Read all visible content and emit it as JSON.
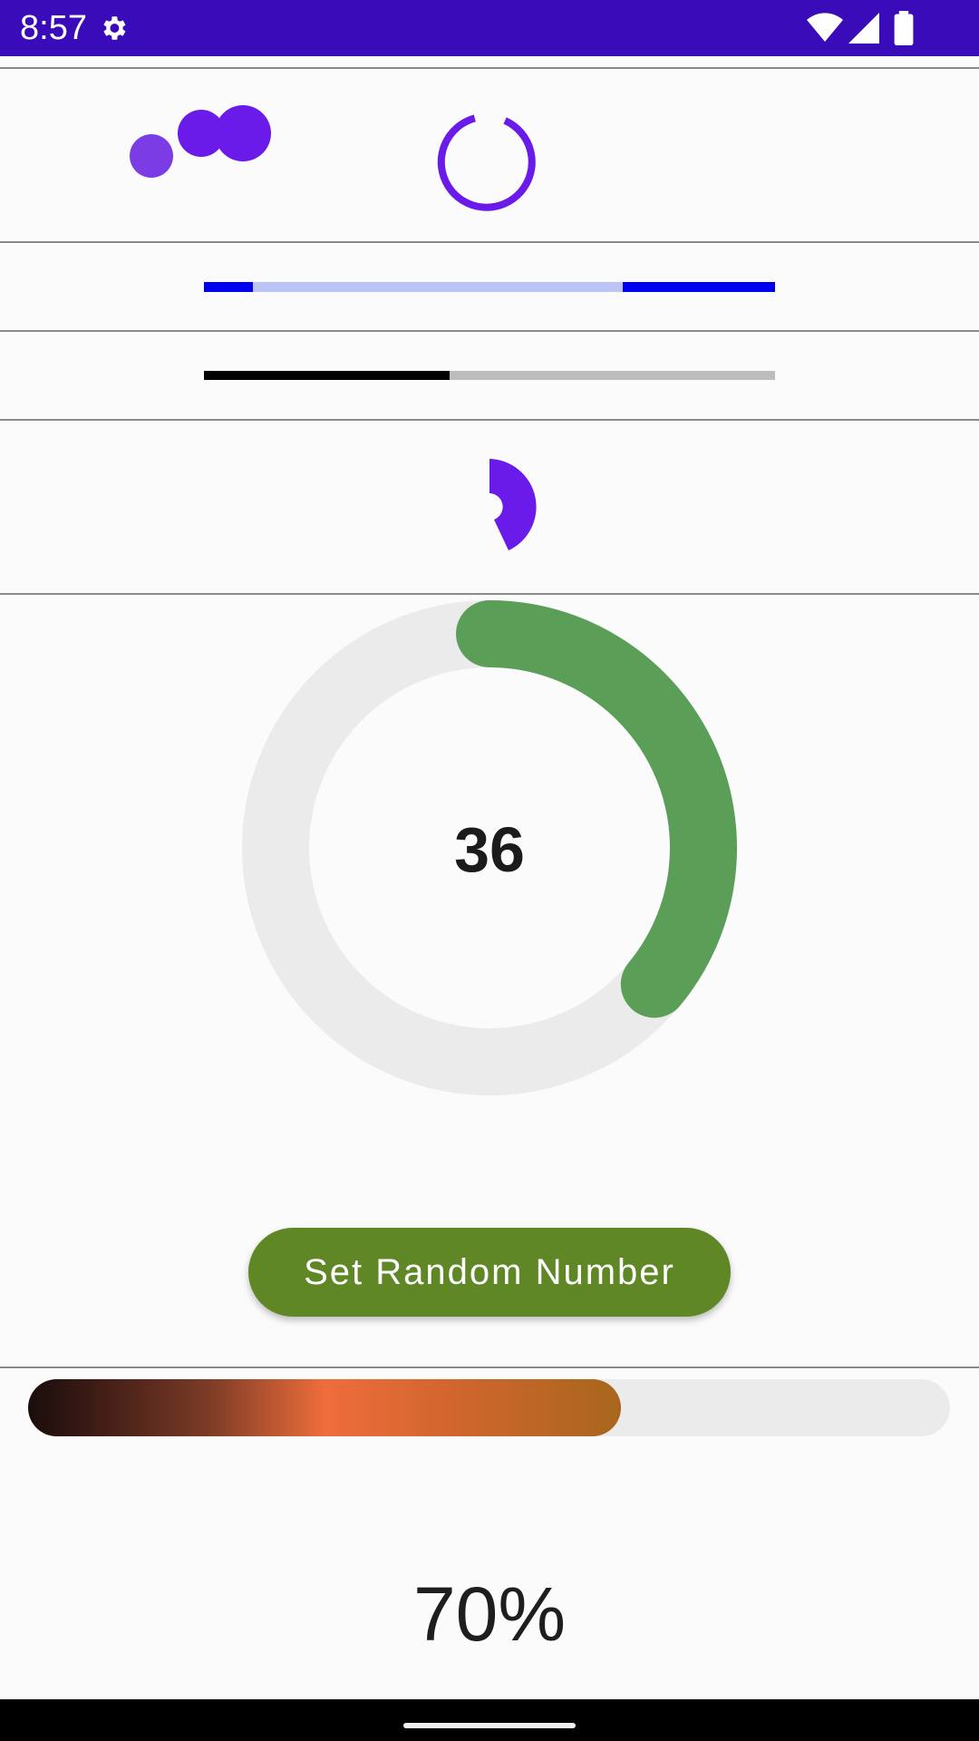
{
  "status_bar": {
    "time": "8:57",
    "background_color": "#3a0bb8",
    "icons": [
      "gear-icon",
      "wifi-icon",
      "signal-icon",
      "battery-icon"
    ]
  },
  "colors": {
    "accent_purple": "#6a1bea",
    "indeterminate_bar_color": "#0000ee",
    "ring_progress_color": "#5a9e58",
    "ring_track_color": "#ebebeb",
    "button_color": "#5f8726"
  },
  "determinate_bar": {
    "progress": 0.43
  },
  "ring": {
    "value": "36",
    "progress": 0.36
  },
  "random_button": {
    "label": "Set Random Number"
  },
  "gradient_bar": {
    "progress": 0.643,
    "label": "70%"
  }
}
